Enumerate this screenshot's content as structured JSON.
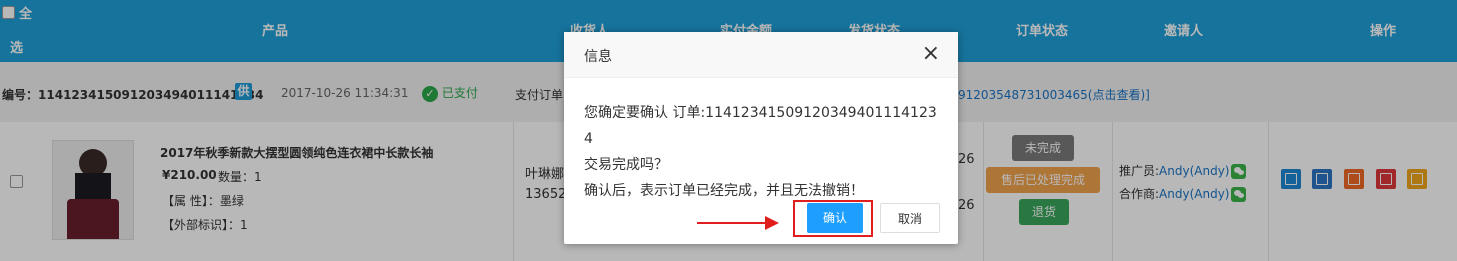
{
  "header": {
    "select_all_1": "全",
    "select_all_2": "选",
    "col_product": "产品",
    "col_receiver": "收货人",
    "col_paid": "实付金额",
    "col_ship": "发货状态",
    "col_order_status": "订单状态",
    "col_inviter": "邀请人",
    "col_ops": "操作"
  },
  "order": {
    "number_label": "编号：",
    "number": "11412341509120349401114123​4",
    "supply_badge": "供",
    "date": "2017-10-26 11:34:31",
    "paid_status": "已支付",
    "pay_order_label": "支付订单",
    "pay_order_link": "91203548731003465(点击查看)]"
  },
  "product": {
    "title": "2017年秋季新款大摆型圆领纯色连衣裙中长款长袖",
    "price": "¥210.00",
    "qty": "数量：1",
    "attr": "【属 性】：墨绿",
    "ext": "【外部标识】：1",
    "receiver_name": "叶琳娜",
    "receiver_phone": "13652",
    "ship_partial_1": "26",
    "ship_partial_2": "26"
  },
  "order_status": {
    "incomplete": "未完成",
    "after_sale": "售后已处理完成",
    "return": "退货"
  },
  "inviter": {
    "promoter_label": "推广员:",
    "promoter": "Andy(Andy)",
    "partner_label": "合作商:",
    "partner": "Andy(Andy)"
  },
  "colors": {
    "header_bg": "#1fa0d9",
    "ok_btn": "#1e9fff",
    "highlight": "#e01e1e"
  },
  "dialog": {
    "title": "信息",
    "close": "×",
    "line1": "您确定要确认 订单:11412341509120349401114123​4",
    "line2": "交易完成吗？",
    "line3": "确认后，表示订单已经完成，并且无法撤销！",
    "ok": "确认",
    "cancel": "取消"
  }
}
